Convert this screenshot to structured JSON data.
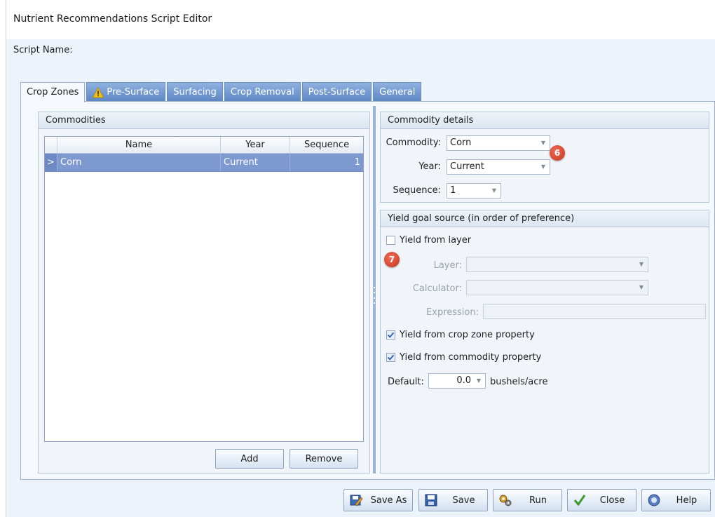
{
  "window": {
    "title": "Nutrient Recommendations Script Editor"
  },
  "script_name_label": "Script Name:",
  "tabs": [
    {
      "label": "Crop Zones",
      "active": true,
      "icon": ""
    },
    {
      "label": "Pre-Surface",
      "active": false,
      "icon": "warning-icon"
    },
    {
      "label": "Surfacing",
      "active": false,
      "icon": ""
    },
    {
      "label": "Crop Removal",
      "active": false,
      "icon": ""
    },
    {
      "label": "Post-Surface",
      "active": false,
      "icon": ""
    },
    {
      "label": "General",
      "active": false,
      "icon": ""
    }
  ],
  "commodities": {
    "header": "Commodities",
    "columns": [
      "Name",
      "Year",
      "Sequence"
    ],
    "rows": [
      {
        "indicator": ">",
        "name": "Corn",
        "year": "Current",
        "sequence": "1"
      }
    ],
    "add_label": "Add",
    "remove_label": "Remove"
  },
  "commodity_details": {
    "header": "Commodity details",
    "commodity_label": "Commodity:",
    "commodity_value": "Corn",
    "year_label": "Year:",
    "year_value": "Current",
    "sequence_label": "Sequence:",
    "sequence_value": "1"
  },
  "yield_goal": {
    "header": "Yield goal source (in order of preference)",
    "from_layer_label": "Yield from layer",
    "from_layer_checked": false,
    "layer_label": "Layer:",
    "layer_value": "",
    "calculator_label": "Calculator:",
    "calculator_value": "",
    "expression_label": "Expression:",
    "expression_value": "",
    "from_crop_zone_label": "Yield from crop zone property",
    "from_crop_zone_checked": true,
    "from_commodity_label": "Yield from commodity property",
    "from_commodity_checked": true,
    "default_label": "Default:",
    "default_value": "0.0",
    "default_unit": "bushels/acre"
  },
  "callouts": {
    "six": "6",
    "seven": "7"
  },
  "buttons": {
    "save_as": "Save As",
    "save": "Save",
    "run": "Run",
    "close": "Close",
    "help": "Help"
  },
  "colors": {
    "tab_inactive": "#5c85c2",
    "row_selected": "#7e98d0",
    "callout": "#d9432d",
    "window_bg": "#edf3fa"
  }
}
